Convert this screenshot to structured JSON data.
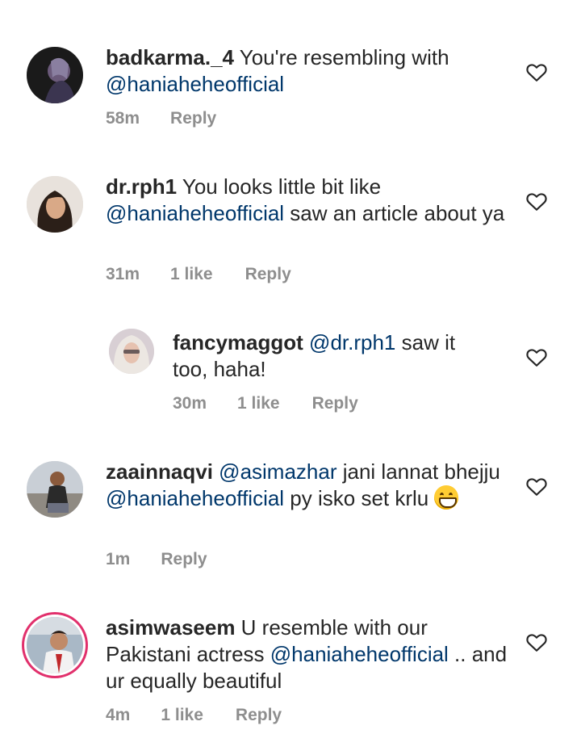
{
  "comments": [
    {
      "username": "badkarma._4",
      "text_parts": [
        " You're resembling with ",
        "@haniaheheofficial"
      ],
      "time": "58m",
      "likes": "",
      "reply": "Reply"
    },
    {
      "username": "dr.rph1",
      "text_parts": [
        " You looks little bit like ",
        "@haniaheheofficial",
        " saw an article about ya"
      ],
      "time": "31m",
      "likes": "1 like",
      "reply": "Reply"
    },
    {
      "username": "fancymaggot",
      "text_parts": [
        " ",
        "@dr.rph1",
        " saw it too, haha!"
      ],
      "time": "30m",
      "likes": "1 like",
      "reply": "Reply"
    },
    {
      "username": "zaainnaqvi",
      "text_parts": [
        " ",
        "@asimazhar",
        " jani lannat bhejju ",
        "@haniaheheofficial",
        " py isko set krlu "
      ],
      "time": "1m",
      "likes": "",
      "reply": "Reply",
      "emoji": "grinning-face"
    },
    {
      "username": "asimwaseem",
      "text_parts": [
        " U resemble with our Pakistani actress ",
        "@haniaheheofficial",
        " .. and ur equally beautiful"
      ],
      "time": "4m",
      "likes": "1 like",
      "reply": "Reply"
    }
  ],
  "colors": {
    "mention": "#00376b",
    "meta": "#8e8e8e",
    "story_ring": "#e1306c"
  },
  "icons": {
    "like": "heart-outline-icon"
  }
}
